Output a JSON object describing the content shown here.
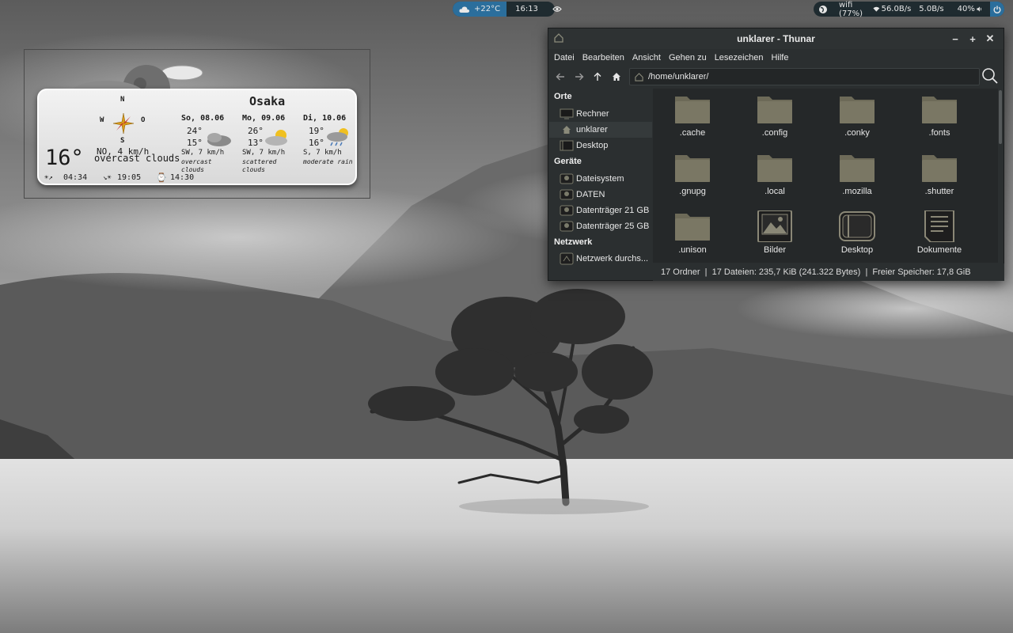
{
  "panel": {
    "weather_temp": "+22°C",
    "clock": "16:13",
    "network": "wifi (77%)",
    "down_speed": "56.0B/s",
    "up_speed": "5.0B/s",
    "volume": "40%"
  },
  "conky": {
    "city": "Osaka",
    "compass": {
      "n": "N",
      "w": "W",
      "o": "O",
      "s": "S"
    },
    "current_temp": "16°",
    "current_wind": "NO, 4 km/h",
    "current_desc": "overcast clouds",
    "sunrise": "04:34",
    "sunset": "19:05",
    "updated": "14:30",
    "forecast": [
      {
        "day": "So, 08.06",
        "high": "24°",
        "low": "15°",
        "wind": "SW, 7 km/h",
        "desc1": "overcast",
        "desc2": "clouds"
      },
      {
        "day": "Mo, 09.06",
        "high": "26°",
        "low": "13°",
        "wind": "SW, 7 km/h",
        "desc1": "scattered",
        "desc2": "clouds"
      },
      {
        "day": "Di, 10.06",
        "high": "19°",
        "low": "16°",
        "wind": "S, 7 km/h",
        "desc1": "moderate rain",
        "desc2": ""
      }
    ]
  },
  "thunar": {
    "title": "unklarer - Thunar",
    "menu": [
      "Datei",
      "Bearbeiten",
      "Ansicht",
      "Gehen zu",
      "Lesezeichen",
      "Hilfe"
    ],
    "path": "/home/unklarer/",
    "sidebar": {
      "places_header": "Orte",
      "places": [
        "Rechner",
        "unklarer",
        "Desktop"
      ],
      "devices_header": "Geräte",
      "devices": [
        "Dateisystem",
        "DATEN",
        "Datenträger 21 GB",
        "Datenträger 25 GB"
      ],
      "network_header": "Netzwerk",
      "network": [
        "Netzwerk durchs..."
      ]
    },
    "files": [
      {
        "name": ".cache",
        "icon": "folder-icon"
      },
      {
        "name": ".config",
        "icon": "folder-icon"
      },
      {
        "name": ".conky",
        "icon": "folder-icon"
      },
      {
        "name": ".fonts",
        "icon": "folder-icon"
      },
      {
        "name": ".gnupg",
        "icon": "folder-icon"
      },
      {
        "name": ".local",
        "icon": "folder-icon"
      },
      {
        "name": ".mozilla",
        "icon": "folder-icon"
      },
      {
        "name": ".shutter",
        "icon": "folder-icon"
      },
      {
        "name": ".unison",
        "icon": "folder-icon"
      },
      {
        "name": "Bilder",
        "icon": "pictures-folder-icon"
      },
      {
        "name": "Desktop",
        "icon": "desktop-folder-icon"
      },
      {
        "name": "Dokumente",
        "icon": "documents-folder-icon"
      }
    ],
    "status": "17 Ordner  |  17 Dateien: 235,7 KiB (241.322 Bytes)  |  Freier Speicher: 17,8 GiB"
  },
  "colors": {
    "panel_bg": "#1f2b30",
    "panel_accent": "#2b6e9c",
    "window_bg": "#2b2f30",
    "folder": "#6d6a58"
  }
}
